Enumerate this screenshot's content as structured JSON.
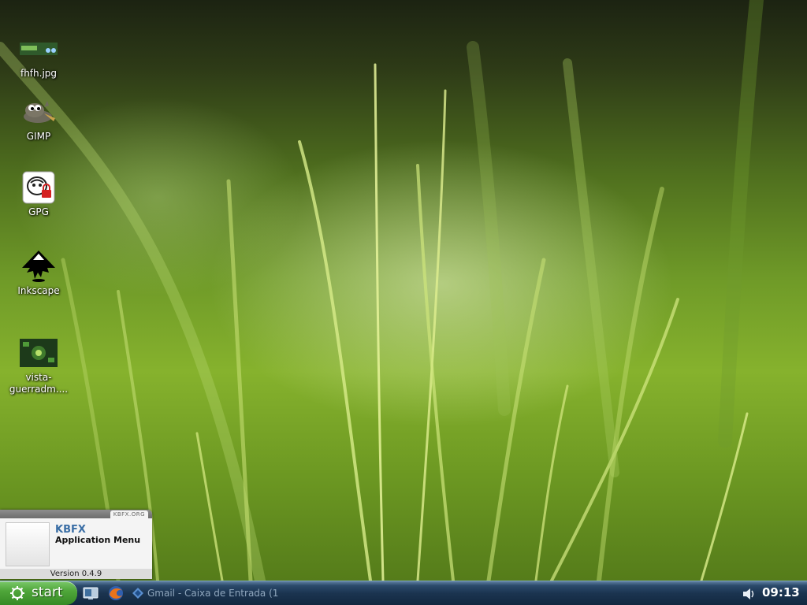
{
  "desktop": {
    "icons": [
      {
        "label": "fhfh.jpg",
        "icon": "image-thumbnail-icon"
      },
      {
        "label": "GIMP",
        "icon": "gimp-icon"
      },
      {
        "label": "GPG",
        "icon": "gpg-icon"
      },
      {
        "label": "Inkscape",
        "icon": "inkscape-icon"
      },
      {
        "label": "vista-\nguerradm....",
        "icon": "image-thumbnail-icon"
      }
    ]
  },
  "kbfx": {
    "site": "KBFX.ORG",
    "title": "KBFX",
    "subtitle": "Application Menu",
    "version": "Version 0.4.9"
  },
  "taskbar": {
    "start_label": "start",
    "quick_launch": [
      "show-desktop-icon",
      "firefox-icon"
    ],
    "tasks": [
      {
        "label": "Gmail - Caixa de Entrada (1",
        "icon": "konqueror-icon"
      }
    ],
    "tray": {
      "volume_icon": "speaker-icon"
    },
    "clock": "09:13"
  },
  "colors": {
    "taskbar": "#1b3450",
    "start_button": "#4fa63a",
    "kbfx_title": "#3a6ea5"
  }
}
